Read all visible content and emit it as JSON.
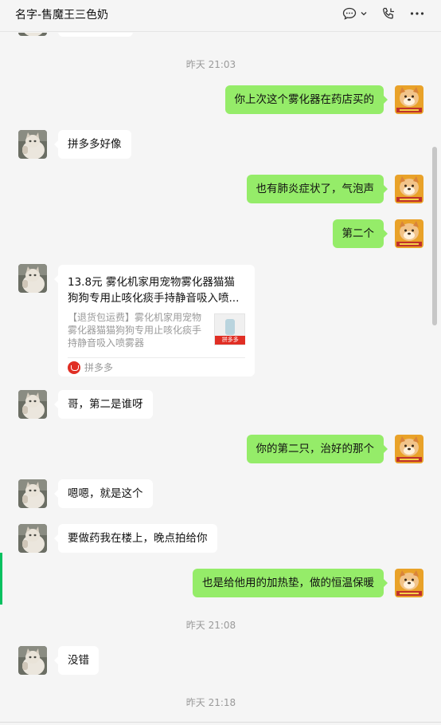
{
  "header": {
    "title": "名字-售魔王三色奶"
  },
  "timestamps": [
    "昨天 21:03",
    "昨天 21:08",
    "昨天 21:18"
  ],
  "messages": {
    "m1": "你上次这个雾化器在药店买的",
    "m2": "拼多多好像",
    "m3": "也有肺炎症状了，气泡声",
    "m4": "第二个",
    "m6": "哥，第二是谁呀",
    "m7": "你的第二只，治好的那个",
    "m8": "嗯嗯，就是这个",
    "m9": "要做药我在楼上，晚点拍给你",
    "m10": "也是给他用的加热垫，做的恒温保暖",
    "m11": "没错"
  },
  "card": {
    "title": "13.8元 雾化机家用宠物雾化器猫猫狗狗专用止咳化痰手持静音吸入喷...",
    "desc": "【退货包运费】雾化机家用宠物雾化器猫猫狗狗专用止咳化痰手持静音吸入喷雾器",
    "source": "拼多多",
    "thumb_label": "拼多多"
  },
  "icons": [
    "chat-bubble-icon",
    "chevron-down-icon",
    "video-call-icon",
    "more-icon"
  ],
  "colors": {
    "sent_bubble": "#95ec69",
    "received_bubble": "#ffffff",
    "background": "#f5f5f5",
    "accent": "#07c160"
  }
}
